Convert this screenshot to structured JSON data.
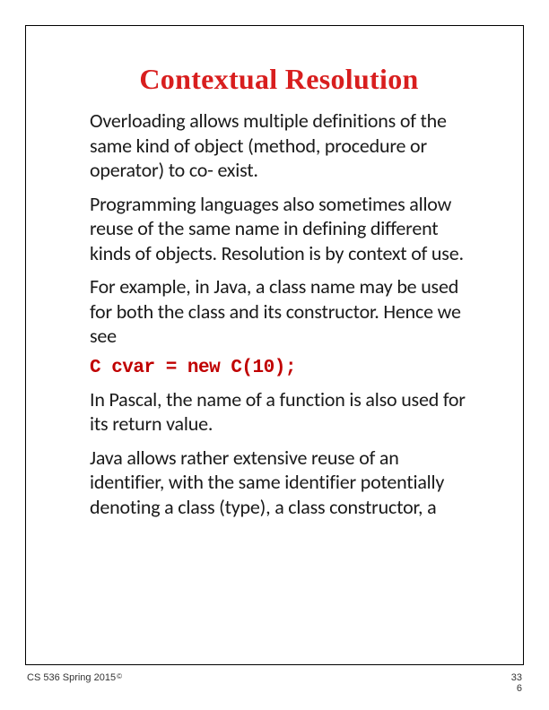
{
  "title": "Contextual Resolution",
  "paragraphs": {
    "p1": "Overloading allows multiple definitions of the same kind of object (method, procedure or operator) to co- exist.",
    "p2": "Programming languages also sometimes allow reuse of the same name in defining different kinds of objects. Resolution is by context of use.",
    "p3": "For example, in Java, a class name may be used for both the class and its constructor. Hence we see",
    "code": "C cvar = new C(10);",
    "p4": "In Pascal, the name of a function is also used for its return value.",
    "p5": "Java allows rather extensive reuse of an identifier, with the same identifier potentially denoting a class (type), a class constructor, a"
  },
  "footer": {
    "course": "CS 536  Spring 2015",
    "copyright": "©",
    "page_top": "33",
    "page_bottom": "6"
  }
}
